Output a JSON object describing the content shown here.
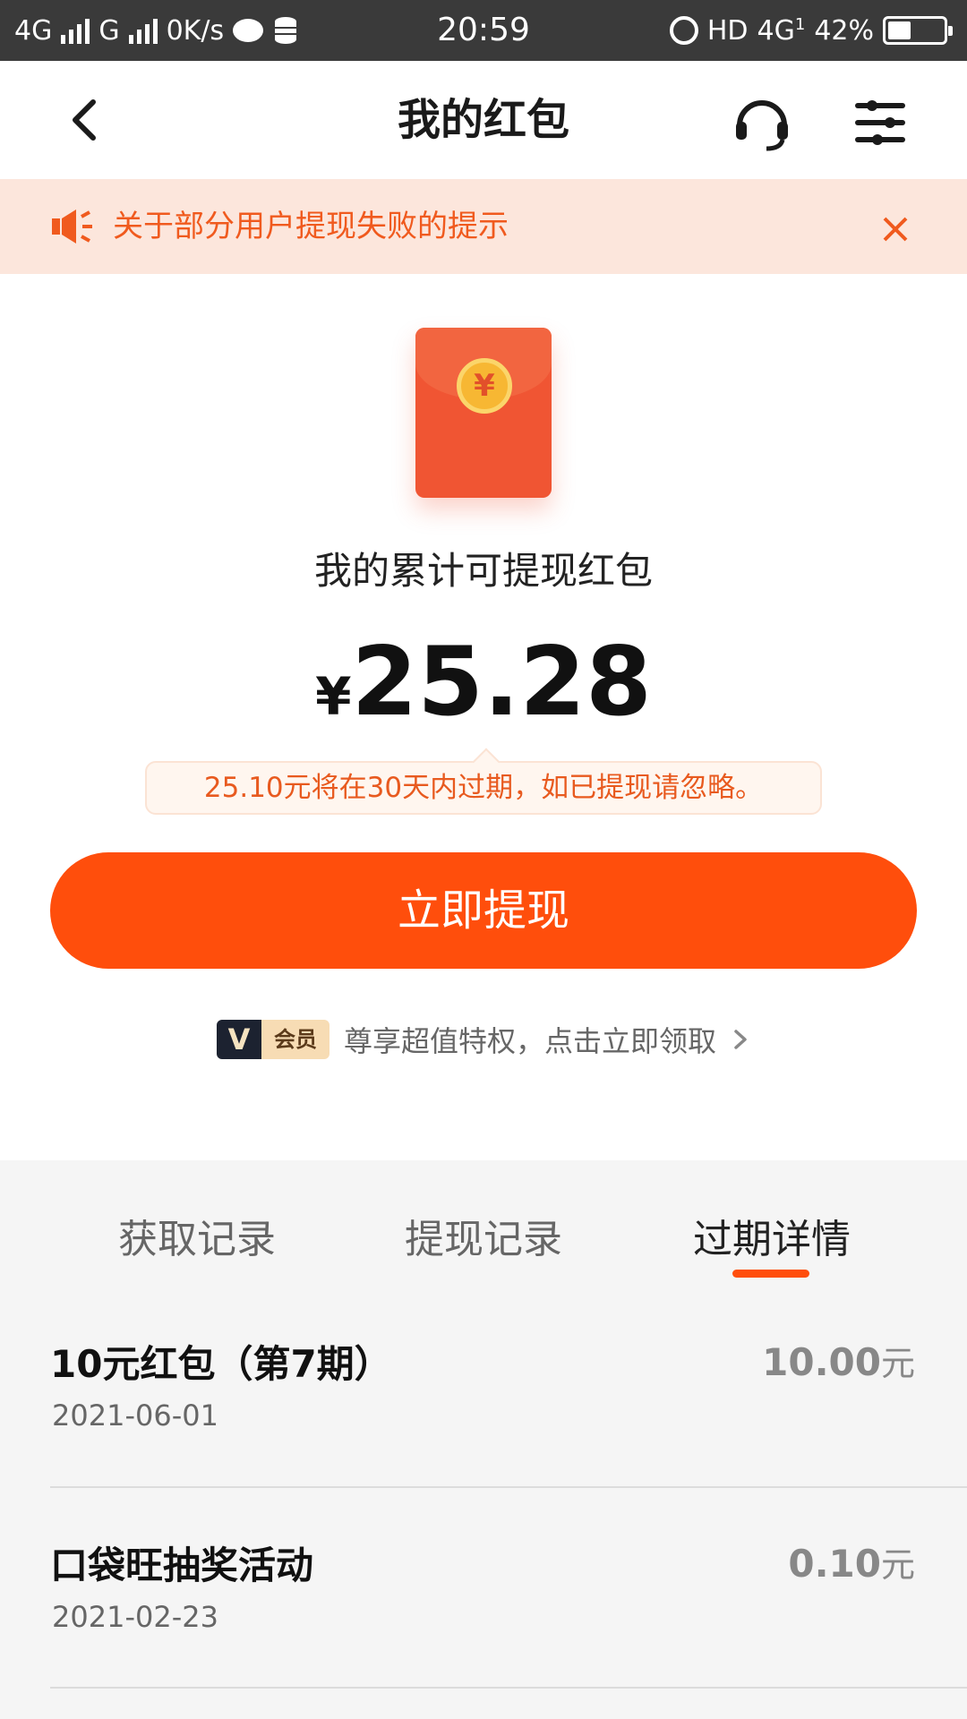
{
  "status_bar": {
    "net1": "4G",
    "net2": "G",
    "speed": "0K/s",
    "time": "20:59",
    "hd": "HD",
    "net3": "4G",
    "net3_sub": "1",
    "battery": "42%",
    "battery_level": 0.42
  },
  "header": {
    "title": "我的红包"
  },
  "notice": {
    "text": "关于部分用户提现失败的提示"
  },
  "summary": {
    "label": "我的累计可提现红包",
    "currency": "¥",
    "amount": "25.28",
    "coin_symbol": "¥",
    "expire_tip": "25.10元将在30天内过期，如已提现请忽略。",
    "withdraw_button": "立即提现"
  },
  "vip": {
    "badge_v": "V",
    "badge_text": "会员",
    "text": "尊享超值特权，点击立即领取"
  },
  "tabs": [
    {
      "label": "获取记录"
    },
    {
      "label": "提现记录"
    },
    {
      "label": "过期详情"
    }
  ],
  "active_tab": "过期详情",
  "records": [
    {
      "title": "10元红包（第7期）",
      "date": "2021-06-01",
      "amount": "10.00",
      "unit": "元"
    },
    {
      "title": "口袋旺抽奖活动",
      "date": "2021-02-23",
      "amount": "0.10",
      "unit": "元"
    }
  ],
  "colors": {
    "accent": "#ff4e0c",
    "notice_bg": "#fce6dc",
    "notice_text": "#f05a1e",
    "envelope": "#f05533"
  }
}
